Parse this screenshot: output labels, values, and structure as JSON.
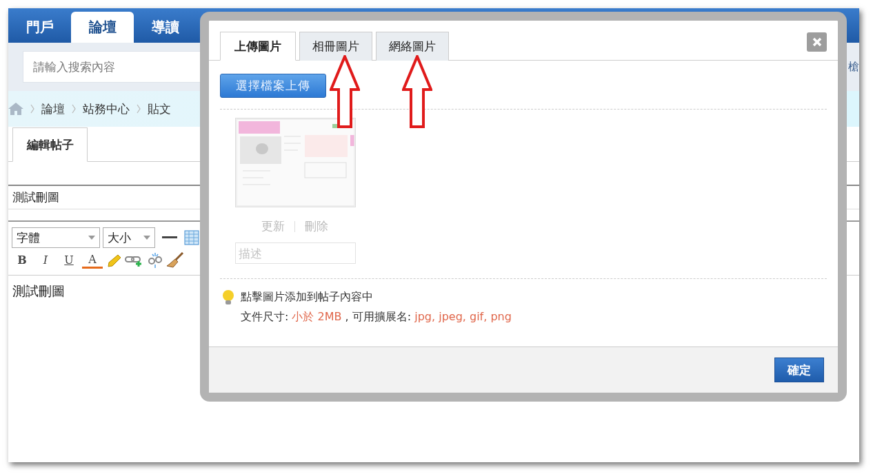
{
  "nav": {
    "items": [
      {
        "label": "門戶",
        "selected": false
      },
      {
        "label": "論壇",
        "selected": true
      },
      {
        "label": "導讀",
        "selected": false
      }
    ]
  },
  "search": {
    "placeholder": "請輸入搜索內容",
    "trailing_text": "槍"
  },
  "breadcrumb": [
    "論壇",
    "站務中心",
    "貼文"
  ],
  "editor": {
    "tabs": [
      {
        "label": "編輯帖子",
        "selected": true
      }
    ],
    "subject": "測試刪圖",
    "font_select": "字體",
    "size_select": "大小",
    "format_buttons": [
      "B",
      "I",
      "U",
      "A"
    ],
    "content": "測試刪圖"
  },
  "dialog": {
    "tabs": [
      {
        "label": "上傳圖片",
        "selected": true
      },
      {
        "label": "相冊圖片",
        "selected": false
      },
      {
        "label": "網絡圖片",
        "selected": false
      }
    ],
    "upload_button": "選擇檔案上傳",
    "image": {
      "kind": "picture",
      "actions": [
        "更新",
        "刪除"
      ],
      "description_placeholder": "描述"
    },
    "tip": "點擊圖片添加到帖子內容中",
    "limits": [
      {
        "text": "文件尺寸: ",
        "highlight": false
      },
      {
        "text": "小於 2MB",
        "highlight": true
      },
      {
        "text": " , 可用擴展名: ",
        "highlight": false
      },
      {
        "text": "jpg, jpeg, gif, png",
        "highlight": true
      }
    ],
    "confirm_button": "確定"
  }
}
